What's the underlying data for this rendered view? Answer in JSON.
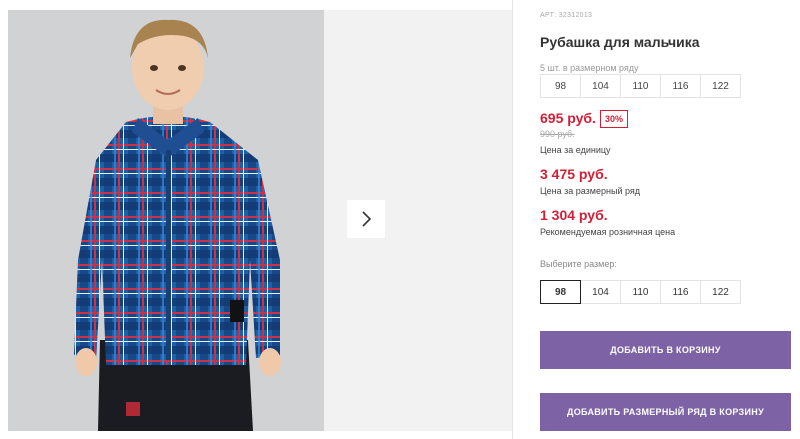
{
  "product": {
    "article_label": "АРТ:",
    "article_number": "32312013",
    "title": "Рубашка для мальчика",
    "series_note": "5 шт. в размерном ряду",
    "series_sizes": [
      "98",
      "104",
      "110",
      "116",
      "122"
    ]
  },
  "prices": {
    "unit_price": "695 руб.",
    "discount": "30%",
    "old_price": "990 руб.",
    "unit_label": "Цена за единицу",
    "series_price": "3 475 руб.",
    "series_label": "Цена за размерный ряд",
    "rrp_price": "1 304 руб.",
    "rrp_label": "Рекомендуемая розничная цена"
  },
  "size_select": {
    "label": "Выберите размер:",
    "options": [
      "98",
      "104",
      "110",
      "116",
      "122"
    ],
    "selected": "98"
  },
  "actions": {
    "add_to_cart": "ДОБАВИТЬ В КОРЗИНУ",
    "add_series_to_cart": "ДОБАВИТЬ РАЗМЕРНЫЙ РЯД В КОРЗИНУ"
  },
  "colors": {
    "accent_red": "#d31f36",
    "button_purple": "#7e62a6"
  },
  "icons": {
    "next": "chevron-right-icon"
  }
}
